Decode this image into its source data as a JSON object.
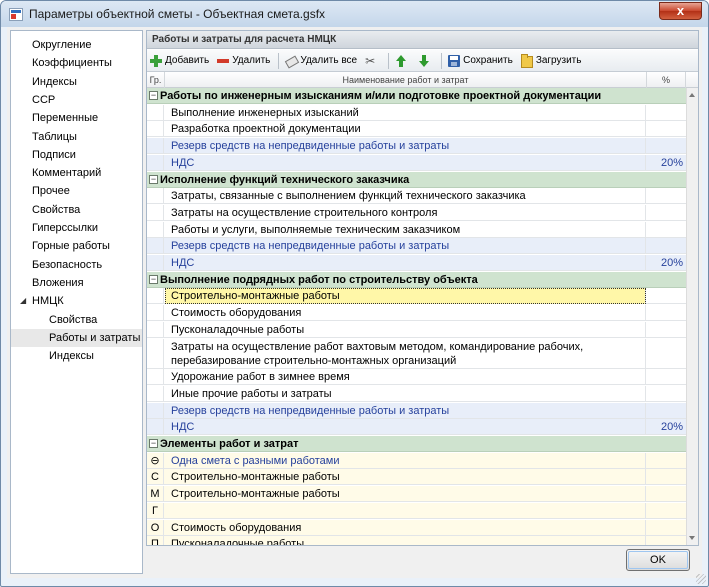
{
  "window": {
    "title": "Параметры объектной сметы - Объектная смета.gsfx",
    "close_glyph": "x"
  },
  "nav": {
    "items": [
      {
        "label": "Округление",
        "level": 0
      },
      {
        "label": "Коэффициенты",
        "level": 0
      },
      {
        "label": "Индексы",
        "level": 0
      },
      {
        "label": "ССР",
        "level": 0
      },
      {
        "label": "Переменные",
        "level": 0
      },
      {
        "label": "Таблицы",
        "level": 0
      },
      {
        "label": "Подписи",
        "level": 0
      },
      {
        "label": "Комментарий",
        "level": 0
      },
      {
        "label": "Прочее",
        "level": 0
      },
      {
        "label": "Свойства",
        "level": 0
      },
      {
        "label": "Гиперссылки",
        "level": 0
      },
      {
        "label": "Горные работы",
        "level": 0
      },
      {
        "label": "Безопасность",
        "level": 0
      },
      {
        "label": "Вложения",
        "level": 0
      },
      {
        "label": "НМЦК",
        "level": 0,
        "expanded": true,
        "toggle": "◢"
      },
      {
        "label": "Свойства",
        "level": 1
      },
      {
        "label": "Работы и затраты",
        "level": 1,
        "selected": true
      },
      {
        "label": "Индексы",
        "level": 1
      }
    ]
  },
  "panel": {
    "title": "Работы и затраты для расчета НМЦК",
    "toolbar": {
      "add": "Добавить",
      "delete": "Удалить",
      "delete_all": "Удалить все",
      "save": "Сохранить",
      "load": "Загрузить"
    },
    "columns": {
      "group": "Гр.",
      "name": "Наименование работ и затрат",
      "percent": "%"
    },
    "rows": [
      {
        "type": "section",
        "name": "Работы по инженерным изысканиям и/или подготовке проектной документации",
        "toggle": "−"
      },
      {
        "type": "normal",
        "name": "Выполнение инженерных изысканий"
      },
      {
        "type": "normal",
        "name": "Разработка проектной документации"
      },
      {
        "type": "blue",
        "name": "Резерв средств на непредвиденные работы и затраты"
      },
      {
        "type": "blue",
        "name": "НДС",
        "percent": "20%"
      },
      {
        "type": "section",
        "name": "Исполнение функций технического заказчика",
        "toggle": "−"
      },
      {
        "type": "normal",
        "name": "Затраты, связанные с выполнением функций технического заказчика"
      },
      {
        "type": "normal",
        "name": "Затраты на осуществление строительного контроля"
      },
      {
        "type": "normal",
        "name": "Работы и услуги, выполняемые техническим заказчиком"
      },
      {
        "type": "blue",
        "name": "Резерв средств на непредвиденные работы и затраты"
      },
      {
        "type": "blue",
        "name": "НДС",
        "percent": "20%"
      },
      {
        "type": "section",
        "name": "Выполнение подрядных работ по строительству объекта",
        "toggle": "−"
      },
      {
        "type": "selected",
        "name": "Строительно-монтажные работы"
      },
      {
        "type": "normal",
        "name": "Стоимость оборудования"
      },
      {
        "type": "normal",
        "name": "Пусконаладочные работы"
      },
      {
        "type": "multi",
        "name": "Затраты на осуществление работ вахтовым методом, командирование рабочих, перебазирование строительно-монтажных организаций"
      },
      {
        "type": "normal",
        "name": "Удорожание работ в зимнее время"
      },
      {
        "type": "normal",
        "name": "Иные прочие работы и затраты"
      },
      {
        "type": "blue",
        "name": "Резерв средств на непредвиденные работы и затраты"
      },
      {
        "type": "blue",
        "name": "НДС",
        "percent": "20%"
      },
      {
        "type": "section",
        "name": "Элементы работ и затрат",
        "toggle": "−"
      },
      {
        "type": "cream",
        "group": "⊖",
        "name": "Одна смета с разными работами",
        "blue_text": true
      },
      {
        "type": "cream",
        "group": "С",
        "name": "Строительно-монтажные работы"
      },
      {
        "type": "cream",
        "group": "М",
        "name": "Строительно-монтажные работы"
      },
      {
        "type": "cream",
        "group": "Г",
        "name": ""
      },
      {
        "type": "cream",
        "group": "О",
        "name": "Стоимость оборудования"
      },
      {
        "type": "cream",
        "group": "П",
        "name": "Пусконаладочные работы"
      }
    ]
  },
  "ok_label": "OK"
}
